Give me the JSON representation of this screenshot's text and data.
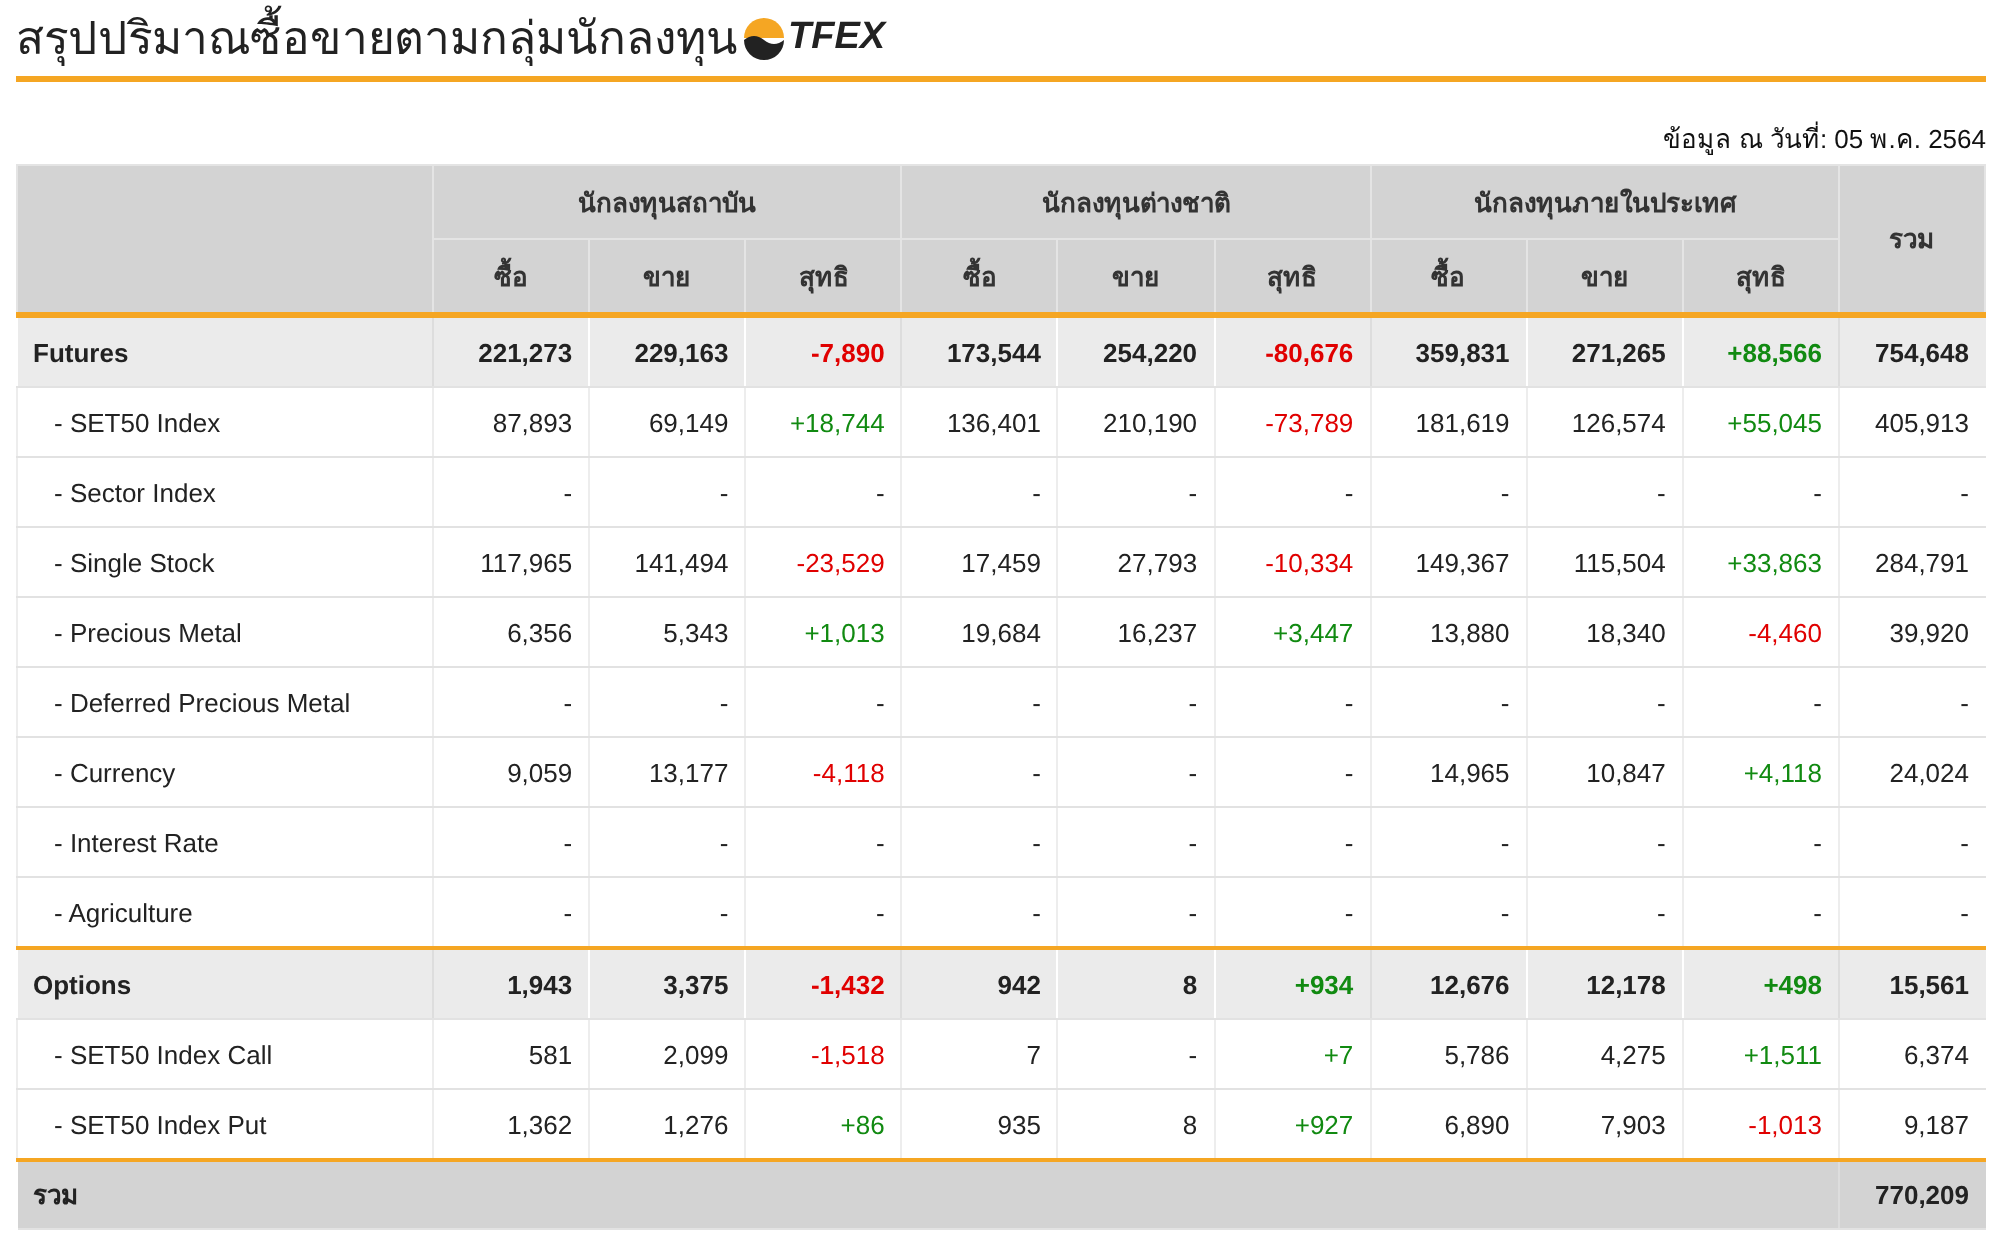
{
  "title": "สรุปปริมาณซื้อขายตามกลุ่มนักลงทุน",
  "logo": "TFEX",
  "date_note": "ข้อมูล ณ วันที่: 05 พ.ค. 2564",
  "table": {
    "groups": [
      "นักลงทุนสถาบัน",
      "นักลงทุนต่างชาติ",
      "นักลงทุนภายในประเทศ"
    ],
    "total_heading": "รวม",
    "subcolumns": [
      "ซื้อ",
      "ขาย",
      "สุทธิ",
      "ซื้อ",
      "ขาย",
      "สุทธิ",
      "ซื้อ",
      "ขาย",
      "สุทธิ"
    ],
    "rows": [
      {
        "kind": "group",
        "label": "Futures",
        "cells": [
          {
            "text": "221,273"
          },
          {
            "text": "229,163"
          },
          {
            "text": "-7,890",
            "color": "#e00000"
          },
          {
            "text": "173,544"
          },
          {
            "text": "254,220"
          },
          {
            "text": "-80,676",
            "color": "#e00000"
          },
          {
            "text": "359,831"
          },
          {
            "text": "271,265"
          },
          {
            "text": "+88,566",
            "color": "#118a11"
          },
          {
            "text": "754,648"
          }
        ]
      },
      {
        "kind": "item",
        "label": "- SET50 Index",
        "cells": [
          {
            "text": "87,893"
          },
          {
            "text": "69,149"
          },
          {
            "text": "+18,744",
            "color": "#118a11"
          },
          {
            "text": "136,401"
          },
          {
            "text": "210,190"
          },
          {
            "text": "-73,789",
            "color": "#e00000"
          },
          {
            "text": "181,619"
          },
          {
            "text": "126,574"
          },
          {
            "text": "+55,045",
            "color": "#118a11"
          },
          {
            "text": "405,913"
          }
        ]
      },
      {
        "kind": "item",
        "label": "- Sector Index",
        "cells": [
          {
            "text": "-"
          },
          {
            "text": "-"
          },
          {
            "text": "-"
          },
          {
            "text": "-"
          },
          {
            "text": "-"
          },
          {
            "text": "-"
          },
          {
            "text": "-"
          },
          {
            "text": "-"
          },
          {
            "text": "-"
          },
          {
            "text": "-"
          }
        ]
      },
      {
        "kind": "item",
        "label": "- Single Stock",
        "cells": [
          {
            "text": "117,965"
          },
          {
            "text": "141,494"
          },
          {
            "text": "-23,529",
            "color": "#e00000"
          },
          {
            "text": "17,459"
          },
          {
            "text": "27,793"
          },
          {
            "text": "-10,334",
            "color": "#e00000"
          },
          {
            "text": "149,367"
          },
          {
            "text": "115,504"
          },
          {
            "text": "+33,863",
            "color": "#118a11"
          },
          {
            "text": "284,791"
          }
        ]
      },
      {
        "kind": "item",
        "label": "- Precious Metal",
        "cells": [
          {
            "text": "6,356"
          },
          {
            "text": "5,343"
          },
          {
            "text": "+1,013",
            "color": "#118a11"
          },
          {
            "text": "19,684"
          },
          {
            "text": "16,237"
          },
          {
            "text": "+3,447",
            "color": "#118a11"
          },
          {
            "text": "13,880"
          },
          {
            "text": "18,340"
          },
          {
            "text": "-4,460",
            "color": "#e00000"
          },
          {
            "text": "39,920"
          }
        ]
      },
      {
        "kind": "item",
        "label": "- Deferred Precious Metal",
        "cells": [
          {
            "text": "-"
          },
          {
            "text": "-"
          },
          {
            "text": "-"
          },
          {
            "text": "-"
          },
          {
            "text": "-"
          },
          {
            "text": "-"
          },
          {
            "text": "-"
          },
          {
            "text": "-"
          },
          {
            "text": "-"
          },
          {
            "text": "-"
          }
        ]
      },
      {
        "kind": "item",
        "label": "- Currency",
        "cells": [
          {
            "text": "9,059"
          },
          {
            "text": "13,177"
          },
          {
            "text": "-4,118",
            "color": "#e00000"
          },
          {
            "text": "-"
          },
          {
            "text": "-"
          },
          {
            "text": "-"
          },
          {
            "text": "14,965"
          },
          {
            "text": "10,847"
          },
          {
            "text": "+4,118",
            "color": "#118a11"
          },
          {
            "text": "24,024"
          }
        ]
      },
      {
        "kind": "item",
        "label": "- Interest Rate",
        "cells": [
          {
            "text": "-"
          },
          {
            "text": "-"
          },
          {
            "text": "-"
          },
          {
            "text": "-"
          },
          {
            "text": "-"
          },
          {
            "text": "-"
          },
          {
            "text": "-"
          },
          {
            "text": "-"
          },
          {
            "text": "-"
          },
          {
            "text": "-"
          }
        ]
      },
      {
        "kind": "item",
        "label": "- Agriculture",
        "cells": [
          {
            "text": "-"
          },
          {
            "text": "-"
          },
          {
            "text": "-"
          },
          {
            "text": "-"
          },
          {
            "text": "-"
          },
          {
            "text": "-"
          },
          {
            "text": "-"
          },
          {
            "text": "-"
          },
          {
            "text": "-"
          },
          {
            "text": "-"
          }
        ]
      },
      {
        "kind": "group",
        "label": "Options",
        "cells": [
          {
            "text": "1,943"
          },
          {
            "text": "3,375"
          },
          {
            "text": "-1,432",
            "color": "#e00000"
          },
          {
            "text": "942"
          },
          {
            "text": "8"
          },
          {
            "text": "+934",
            "color": "#118a11"
          },
          {
            "text": "12,676"
          },
          {
            "text": "12,178"
          },
          {
            "text": "+498",
            "color": "#118a11"
          },
          {
            "text": "15,561"
          }
        ]
      },
      {
        "kind": "item",
        "label": "- SET50 Index Call",
        "cells": [
          {
            "text": "581"
          },
          {
            "text": "2,099"
          },
          {
            "text": "-1,518",
            "color": "#e00000"
          },
          {
            "text": "7"
          },
          {
            "text": "-"
          },
          {
            "text": "+7",
            "color": "#118a11"
          },
          {
            "text": "5,786"
          },
          {
            "text": "4,275"
          },
          {
            "text": "+1,511",
            "color": "#118a11"
          },
          {
            "text": "6,374"
          }
        ]
      },
      {
        "kind": "item",
        "label": "- SET50 Index Put",
        "cells": [
          {
            "text": "1,362"
          },
          {
            "text": "1,276"
          },
          {
            "text": "+86",
            "color": "#118a11"
          },
          {
            "text": "935"
          },
          {
            "text": "8"
          },
          {
            "text": "+927",
            "color": "#118a11"
          },
          {
            "text": "6,890"
          },
          {
            "text": "7,903"
          },
          {
            "text": "-1,013",
            "color": "#e00000"
          },
          {
            "text": "9,187"
          }
        ]
      }
    ],
    "total": {
      "label": "รวม",
      "value": "770,209"
    }
  }
}
